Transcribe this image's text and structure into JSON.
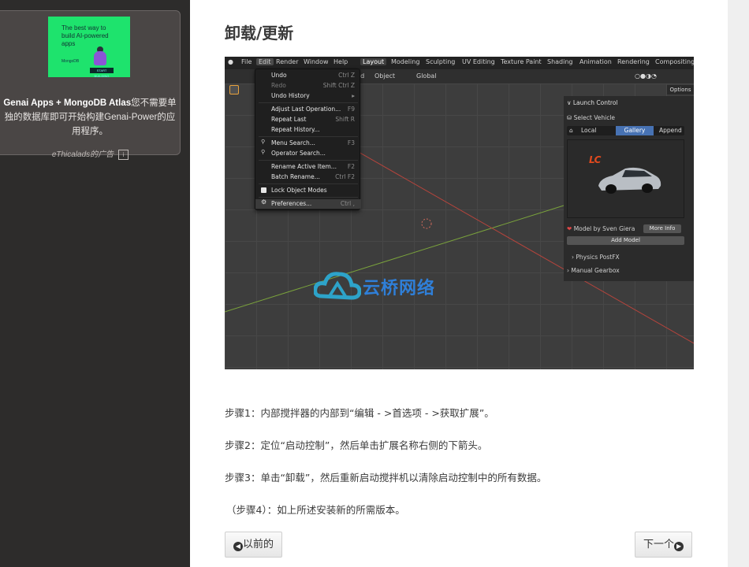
{
  "ad": {
    "thumb_text": "The best way to build AI-powered apps",
    "thumb_logo": "MongoDB",
    "thumb_button": "START BUILDING",
    "headline_bold": "Genai Apps + MongoDB Atlas",
    "headline_rest": "您不需要单独的数据库即可开始构建Genai-Power的应用程序。",
    "sponsor": "eThicalads的广告",
    "info_glyph": "i"
  },
  "article": {
    "title": "卸载/更新",
    "steps": [
      "步骤1：内部搅拌器的内部到“编辑 - >首选项 - >获取扩展”。",
      "步骤2：定位“启动控制”，然后单击扩展名称右侧的下箭头。",
      "步骤3：单击“卸载”，然后重新启动搅拌机以清除启动控制中的所有数据。",
      "（步骤4）：如上所述安装新的所需版本。"
    ],
    "prev_label": "以前的",
    "next_label": "下一个",
    "prev_icon": "circle-left-arrow",
    "next_icon": "circle-right-arrow"
  },
  "blender": {
    "menubar": [
      "File",
      "Edit",
      "Render",
      "Window",
      "Help"
    ],
    "workspaces": [
      "Layout",
      "Modeling",
      "Sculpting",
      "UV Editing",
      "Texture Paint",
      "Shading",
      "Animation",
      "Rendering",
      "Compositing"
    ],
    "toolbar": {
      "add": "dd",
      "object": "Object",
      "transform": "Global"
    },
    "options": "Options",
    "edit_menu": [
      {
        "label": "Undo",
        "shortcut": "Ctrl Z",
        "dim": false
      },
      {
        "label": "Redo",
        "shortcut": "Shift Ctrl Z",
        "dim": true
      },
      {
        "label": "Undo History",
        "shortcut": "",
        "dim": false
      },
      {
        "label": "Adjust Last Operation...",
        "shortcut": "F9",
        "dim": false
      },
      {
        "label": "Repeat Last",
        "shortcut": "Shift R",
        "dim": false
      },
      {
        "label": "Repeat History...",
        "shortcut": "",
        "dim": false
      },
      {
        "label": "Menu Search...",
        "shortcut": "F3",
        "dim": false
      },
      {
        "label": "Operator Search...",
        "shortcut": "",
        "dim": false
      },
      {
        "label": "Rename Active Item...",
        "shortcut": "F2",
        "dim": false
      },
      {
        "label": "Batch Rename...",
        "shortcut": "Ctrl F2",
        "dim": false
      },
      {
        "label": "Lock Object Modes",
        "shortcut": "",
        "dim": false
      },
      {
        "label": "Preferences...",
        "shortcut": "Ctrl ,",
        "dim": false
      }
    ],
    "panel": {
      "header": "Launch Control",
      "select_vehicle": "Select Vehicle",
      "tabs": [
        "Local",
        "Gallery",
        "Append"
      ],
      "credit": "Model by Sven Giera",
      "more_info": "More Info",
      "add_model": "Add Model",
      "physics": "Physics PostFX",
      "gearbox": "Manual Gearbox"
    },
    "watermark": "云桥网络"
  }
}
